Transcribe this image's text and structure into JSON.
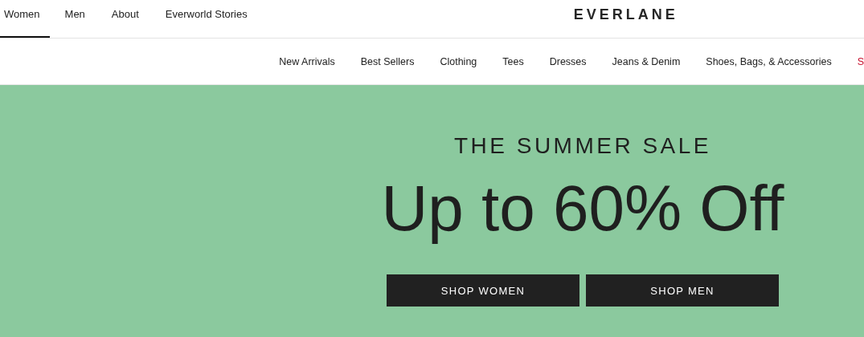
{
  "top_tabs": [
    {
      "label": "Women",
      "selected": true
    },
    {
      "label": "Men",
      "selected": false
    },
    {
      "label": "About",
      "selected": false
    },
    {
      "label": "Everworld Stories",
      "selected": false
    }
  ],
  "logo": "EVERLANE",
  "categories": [
    {
      "label": "New Arrivals",
      "color": "#212121"
    },
    {
      "label": "Best Sellers",
      "color": "#212121"
    },
    {
      "label": "Clothing",
      "color": "#212121"
    },
    {
      "label": "Tees",
      "color": "#212121"
    },
    {
      "label": "Dresses",
      "color": "#212121"
    },
    {
      "label": "Jeans & Denim",
      "color": "#212121"
    },
    {
      "label": "Shoes, Bags, & Accessories",
      "color": "#212121"
    },
    {
      "label": "S",
      "color": "#c8102e"
    }
  ],
  "hero": {
    "eyebrow": "THE SUMMER SALE",
    "headline": "Up to 60% Off",
    "buttons": [
      "SHOP WOMEN",
      "SHOP MEN"
    ]
  }
}
